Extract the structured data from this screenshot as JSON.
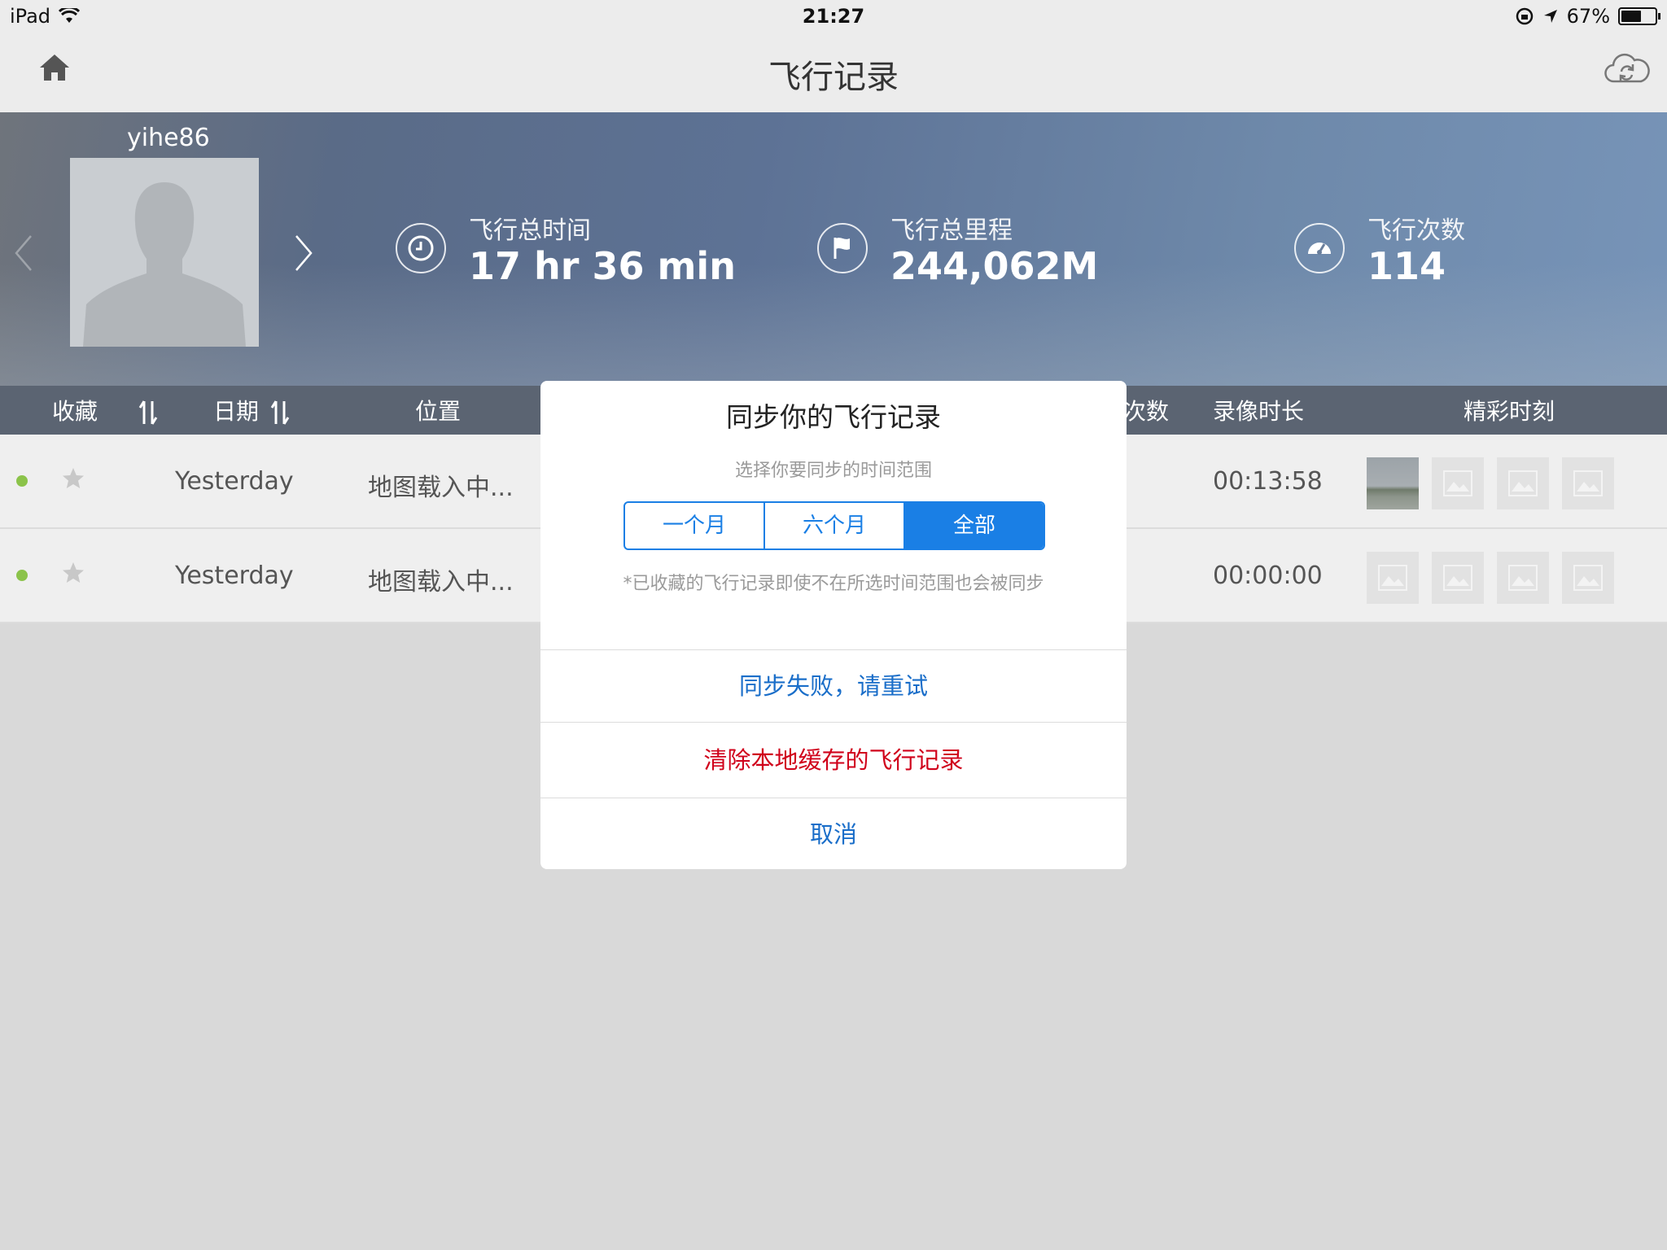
{
  "status_bar": {
    "device": "iPad",
    "time": "21:27",
    "battery": "67%",
    "battery_level": 0.67
  },
  "nav": {
    "title": "飞行记录"
  },
  "profile": {
    "username": "yihe86",
    "stats": [
      {
        "label": "飞行总时间",
        "value": "17 hr 36 min",
        "icon": "clock-icon"
      },
      {
        "label": "飞行总里程",
        "value": "244,062M",
        "icon": "flag-icon"
      },
      {
        "label": "飞行次数",
        "value": "114",
        "icon": "speedometer-icon"
      }
    ]
  },
  "columns": {
    "favorite": "收藏",
    "date": "日期",
    "location": "位置",
    "count": "次数",
    "video_duration": "录像时长",
    "highlights": "精彩时刻"
  },
  "rows": [
    {
      "date": "Yesterday",
      "location": "地图载入中...",
      "duration": "00:13:58"
    },
    {
      "date": "Yesterday",
      "location": "地图载入中...",
      "duration": "00:00:00"
    }
  ],
  "modal": {
    "title": "同步你的飞行记录",
    "subtitle": "选择你要同步的时间范围",
    "options": [
      "一个月",
      "六个月",
      "全部"
    ],
    "selected": "全部",
    "note": "*已收藏的飞行记录即使不在所选时间范围也会被同步",
    "retry": "同步失败，请重试",
    "clear": "清除本地缓存的飞行记录",
    "cancel": "取消"
  },
  "colors": {
    "accent": "#1a7fe5",
    "danger": "#d0021b",
    "status_green": "#8bc34a",
    "header_bar": "#5b6472"
  }
}
